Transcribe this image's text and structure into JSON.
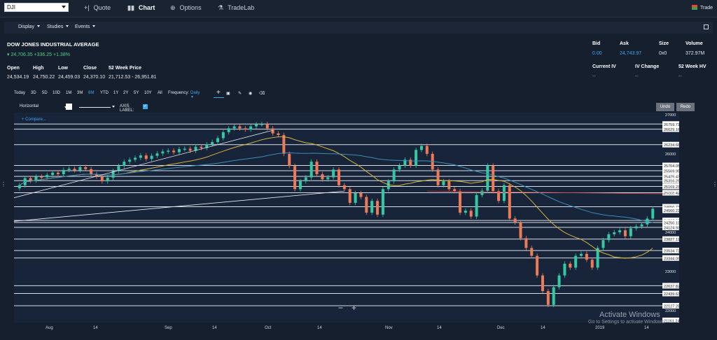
{
  "topnav": {
    "symbol_value": "DJI",
    "items": [
      {
        "label": "Quote",
        "icon": "quote-icon",
        "active": false
      },
      {
        "label": "Chart",
        "icon": "chart-icon",
        "active": true
      },
      {
        "label": "Options",
        "icon": "options-icon",
        "active": false
      },
      {
        "label": "TradeLab",
        "icon": "flask-icon",
        "active": false
      }
    ],
    "trade_label": "Trade"
  },
  "toolbar2": {
    "display_label": "Display",
    "studies_label": "Studies",
    "events_label": "Events"
  },
  "quote": {
    "title": "DOW JONES INDUSTRIAL AVERAGE",
    "last_line": "24,706.35 +336.25 +1.38%",
    "stats": {
      "open_label": "Open",
      "open_value": "24,534.19",
      "high_label": "High",
      "high_value": "24,750.22",
      "low_label": "Low",
      "low_value": "24,459.03",
      "close_label": "Close",
      "close_value": "24,370.10",
      "week52_label": "52 Week Price",
      "week52_value": "21,712.53 - 26,951.81"
    },
    "right": {
      "bid_label": "Bid",
      "bid_value": "0.00",
      "ask_label": "Ask",
      "ask_value": "24,743.97",
      "size_label": "Size",
      "size_value": "0x0",
      "volume_label": "Volume",
      "volume_value": "372.97M",
      "curiv_label": "Current IV",
      "curiv_value": "--",
      "ivchg_label": "IV Change",
      "ivchg_value": "--",
      "hv_label": "52 Week HV",
      "hv_value": "--"
    }
  },
  "chart_toolbar": {
    "ranges": [
      "Today",
      "3D",
      "5D",
      "10D",
      "1M",
      "3M",
      "6M",
      "YTD",
      "1Y",
      "2Y",
      "5Y",
      "10Y",
      "All"
    ],
    "active_range": "6M",
    "frequency_label": "Frequency:",
    "frequency_value": "Daily",
    "line_type": "Horizontal",
    "axis_label": "AXIS LABEL:",
    "undo_label": "Undo",
    "redo_label": "Redo",
    "compare_label": "+ Compare..."
  },
  "chart_data": {
    "type": "candlestick",
    "x_ticks": [
      "Aug",
      "14",
      "Sep",
      "14",
      "Oct",
      "14",
      "Nov",
      "14",
      "Dec",
      "14",
      "2019",
      "14"
    ],
    "y_ticks": [
      27000,
      26000,
      25000,
      24000,
      23000,
      22000
    ],
    "ylim": [
      21700,
      27050
    ],
    "level_labels": [
      "26759.71",
      "26629.16",
      "26234.68",
      "25704.05",
      "25569.95",
      "25425.43",
      "25316.25",
      "25169.23",
      "25008.42",
      "24650.73",
      "24560.22",
      "24302.15",
      "24250.12",
      "24124.93",
      "23827.11",
      "23534.72",
      "23344.09",
      "22637.82",
      "22439.63",
      "22127.25",
      "21161.24"
    ],
    "levels": [
      26759.71,
      26629.16,
      26234.68,
      25704.05,
      25569.95,
      25425.43,
      25316.25,
      25169.23,
      25008.42,
      24650.73,
      24302.15,
      24250.12,
      24124.93,
      23827.11,
      23534.72,
      23344.09,
      22637.82,
      22439.63,
      22127.25
    ],
    "candles": [
      25200,
      25380,
      25320,
      25420,
      25400,
      25460,
      25520,
      25480,
      25590,
      25620,
      25580,
      25660,
      25610,
      25480,
      25420,
      25300,
      25390,
      25560,
      25690,
      25800,
      25850,
      25900,
      25960,
      25870,
      25950,
      26010,
      26060,
      26080,
      26040,
      26120,
      26130,
      26080,
      26180,
      26150,
      26240,
      26300,
      26400,
      26550,
      26650,
      26700,
      26650,
      26620,
      26700,
      26750,
      26760,
      26650,
      26520,
      26480,
      26000,
      25690,
      25100,
      25300,
      25400,
      25800,
      25480,
      25350,
      25400,
      25600,
      25200,
      25100,
      24750,
      25000,
      24900,
      24500,
      24800,
      24450,
      25100,
      25300,
      25600,
      25700,
      25850,
      25700,
      26100,
      26200,
      26000,
      25600,
      25200,
      25300,
      25100,
      25050,
      24500,
      24550,
      24400,
      24950,
      25060,
      25700,
      25050,
      24800,
      25200,
      24350,
      24250,
      23850,
      23600,
      23400,
      22900,
      22500,
      22150,
      22600,
      22900,
      23200,
      23100,
      23400,
      23450,
      23300,
      23100,
      23600,
      23800,
      23950,
      24000,
      24050,
      23900,
      24100,
      24150,
      24200,
      24350,
      24600
    ]
  },
  "zoom": {
    "minus": "−",
    "plus": "+"
  },
  "watermark": {
    "title": "Activate Windows",
    "subtitle": "Go to Settings to activate Windows."
  }
}
